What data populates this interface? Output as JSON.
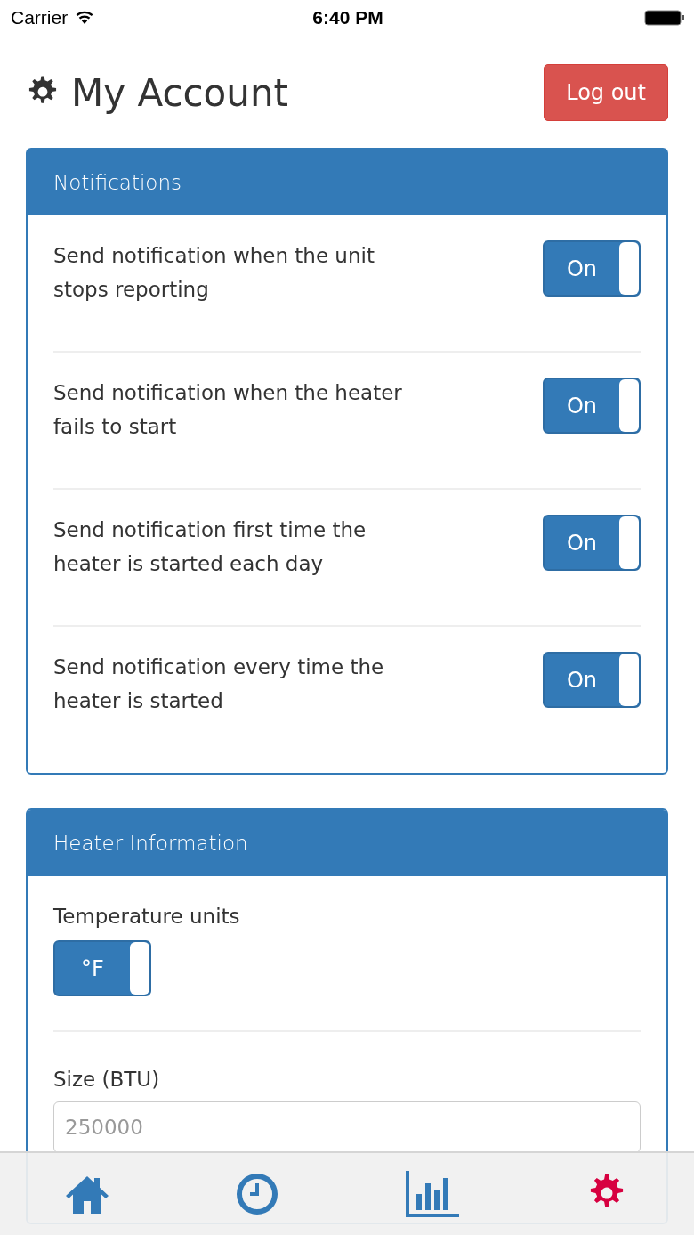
{
  "status_bar": {
    "carrier": "Carrier",
    "time": "6:40 PM"
  },
  "header": {
    "title": "My Account",
    "logout_button": "Log out"
  },
  "notifications": {
    "title": "Notifications",
    "items": [
      {
        "label": "Send notification when the unit stops reporting",
        "toggle": "On",
        "on": true
      },
      {
        "label": "Send notification when the heater fails to start",
        "toggle": "On",
        "on": true
      },
      {
        "label": "Send notification first time the heater is started each day",
        "toggle": "On",
        "on": true
      },
      {
        "label": "Send notification every time the heater is started",
        "toggle": "On",
        "on": true
      }
    ]
  },
  "heater_information": {
    "title": "Heater Information",
    "temperature_units": {
      "label": "Temperature units",
      "toggle": "°F",
      "on": true
    },
    "size": {
      "label": "Size (BTU)",
      "placeholder": "250000"
    }
  },
  "tab_bar": [
    {
      "kind": "home",
      "selected": false
    },
    {
      "kind": "history",
      "selected": false
    },
    {
      "kind": "chart",
      "selected": false
    },
    {
      "kind": "settings",
      "selected": true
    }
  ]
}
